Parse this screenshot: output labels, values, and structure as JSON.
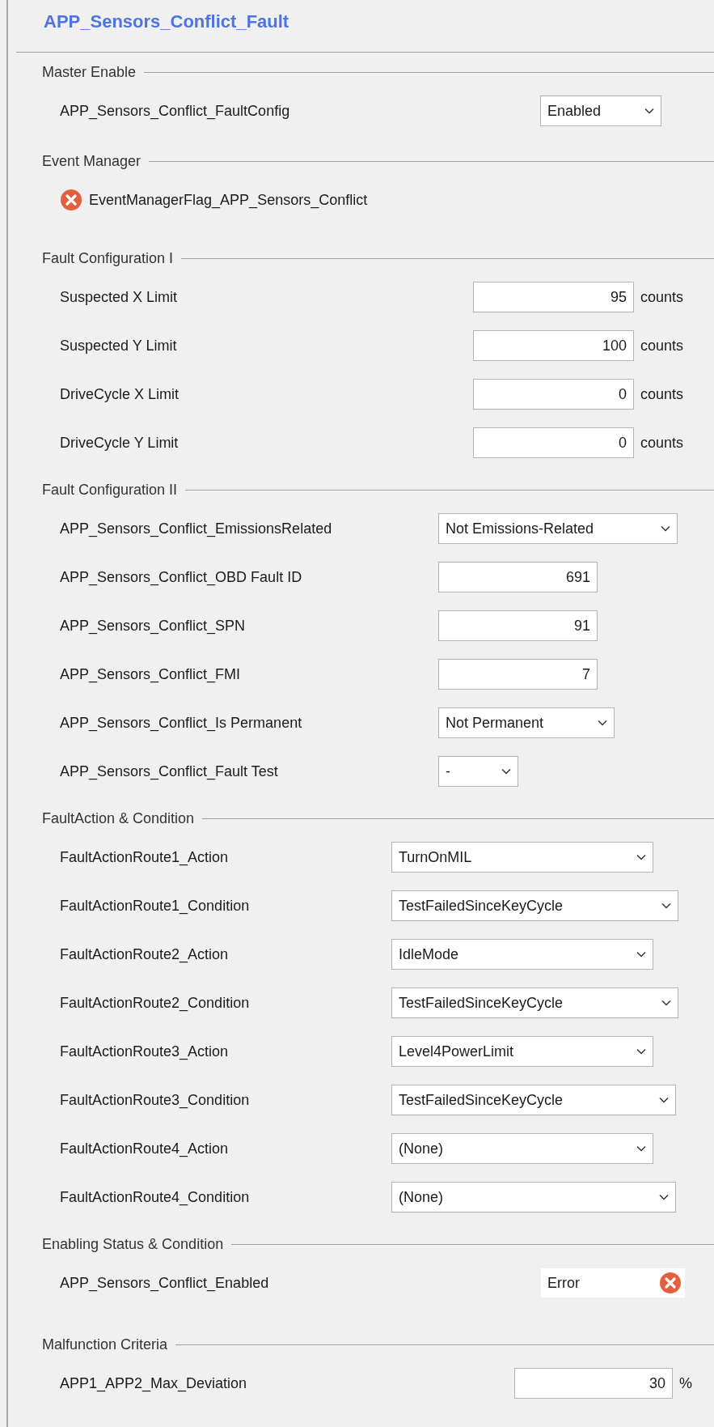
{
  "title": "APP_Sensors_Conflict_Fault",
  "sections": [
    {
      "heading": "Master Enable",
      "rows": [
        {
          "kind": "dropdown",
          "label": "APP_Sensors_Conflict_FaultConfig",
          "value": "Enabled"
        }
      ]
    },
    {
      "heading": "Event Manager",
      "rows": [
        {
          "kind": "flag",
          "label": "EventManagerFlag_APP_Sensors_Conflict",
          "error": true
        }
      ]
    },
    {
      "heading": "Fault Configuration I",
      "rows": [
        {
          "kind": "number",
          "label": "Suspected X Limit",
          "value": "95",
          "unit": "counts"
        },
        {
          "kind": "number",
          "label": "Suspected Y Limit",
          "value": "100",
          "unit": "counts"
        },
        {
          "kind": "number",
          "label": "DriveCycle X Limit",
          "value": "0",
          "unit": "counts"
        },
        {
          "kind": "number",
          "label": "DriveCycle Y Limit",
          "value": "0",
          "unit": "counts"
        }
      ]
    },
    {
      "heading": "Fault Configuration II",
      "rows": [
        {
          "kind": "dropdown",
          "label": "APP_Sensors_Conflict_EmissionsRelated",
          "value": "Not Emissions-Related"
        },
        {
          "kind": "number",
          "label": "APP_Sensors_Conflict_OBD Fault ID",
          "value": "691"
        },
        {
          "kind": "number",
          "label": "APP_Sensors_Conflict_SPN",
          "value": "91"
        },
        {
          "kind": "number",
          "label": "APP_Sensors_Conflict_FMI",
          "value": "7"
        },
        {
          "kind": "dropdown",
          "label": "APP_Sensors_Conflict_Is Permanent",
          "value": "Not Permanent"
        },
        {
          "kind": "dropdown",
          "label": "APP_Sensors_Conflict_Fault Test",
          "value": "-"
        }
      ]
    },
    {
      "heading": "FaultAction & Condition",
      "rows": [
        {
          "kind": "dropdown",
          "label": "FaultActionRoute1_Action",
          "value": "TurnOnMIL"
        },
        {
          "kind": "dropdown",
          "label": "FaultActionRoute1_Condition",
          "value": "TestFailedSinceKeyCycle"
        },
        {
          "kind": "dropdown",
          "label": "FaultActionRoute2_Action",
          "value": "IdleMode"
        },
        {
          "kind": "dropdown",
          "label": "FaultActionRoute2_Condition",
          "value": "TestFailedSinceKeyCycle"
        },
        {
          "kind": "dropdown",
          "label": "FaultActionRoute3_Action",
          "value": "Level4PowerLimit"
        },
        {
          "kind": "dropdown",
          "label": "FaultActionRoute3_Condition",
          "value": "TestFailedSinceKeyCycle"
        },
        {
          "kind": "dropdown",
          "label": "FaultActionRoute4_Action",
          "value": "(None)"
        },
        {
          "kind": "dropdown",
          "label": "FaultActionRoute4_Condition",
          "value": "(None)"
        }
      ]
    },
    {
      "heading": "Enabling Status & Condition",
      "rows": [
        {
          "kind": "status",
          "label": "APP_Sensors_Conflict_Enabled",
          "value": "Error",
          "error": true
        }
      ]
    },
    {
      "heading": "Malfunction Criteria",
      "rows": [
        {
          "kind": "number",
          "label": "APP1_APP2_Max_Deviation",
          "value": "30",
          "unit": "%"
        }
      ]
    }
  ]
}
